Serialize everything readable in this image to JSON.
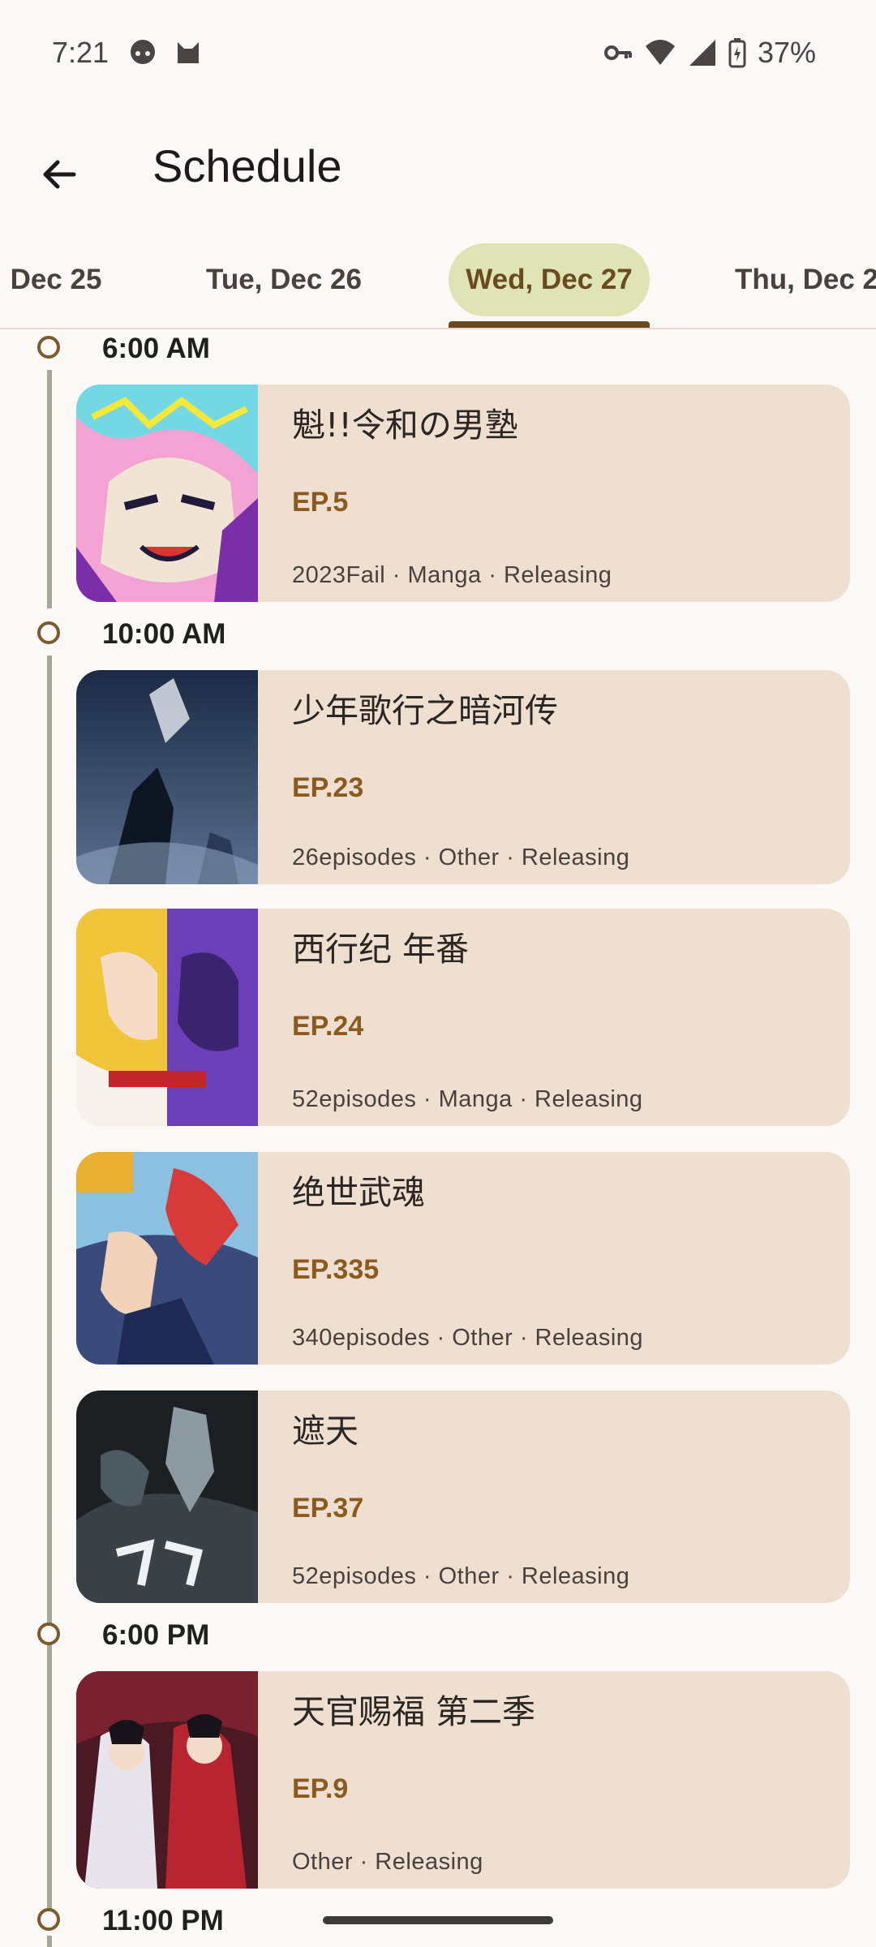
{
  "status_bar": {
    "time": "7:21",
    "battery": "37%"
  },
  "header": {
    "title": "Schedule",
    "back_icon": "arrow-left-icon"
  },
  "tabs": [
    {
      "label": "Dec 25"
    },
    {
      "label": "Tue, Dec 26"
    },
    {
      "label": "Wed, Dec 27",
      "selected": true
    },
    {
      "label": "Thu, Dec 2"
    }
  ],
  "schedule": [
    {
      "time": "6:00 AM",
      "entries": [
        {
          "title": "魁!!令和の男塾",
          "episode": "EP.5",
          "meta": "2023Fail · Manga · Releasing"
        }
      ]
    },
    {
      "time": "10:00 AM",
      "entries": [
        {
          "title": "少年歌行之暗河传",
          "episode": "EP.23",
          "meta": "26episodes · Other · Releasing"
        },
        {
          "title": "西行纪 年番",
          "episode": "EP.24",
          "meta": "52episodes · Manga · Releasing"
        },
        {
          "title": "绝世武魂",
          "episode": "EP.335",
          "meta": "340episodes · Other · Releasing"
        },
        {
          "title": "遮天",
          "episode": "EP.37",
          "meta": "52episodes · Other · Releasing"
        }
      ]
    },
    {
      "time": "6:00 PM",
      "entries": [
        {
          "title": "天官赐福 第二季",
          "episode": "EP.9",
          "meta": "Other · Releasing"
        }
      ]
    },
    {
      "time": "11:00 PM",
      "entries": []
    }
  ],
  "colors": {
    "accent": "#8a5a1f",
    "card_bg": "#eedfd1",
    "tab_selected_bg": "#dfe4b6"
  }
}
